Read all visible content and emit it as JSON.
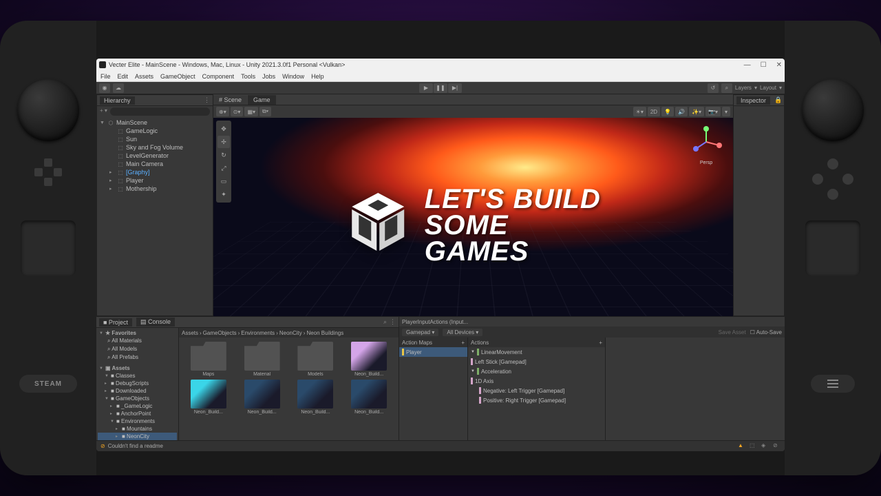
{
  "device": {
    "brand": "STEAM"
  },
  "window": {
    "title": "Vecter Elite - MainScene - Windows, Mac, Linux - Unity 2021.3.0f1 Personal <Vulkan>",
    "menubar": [
      "File",
      "Edit",
      "Assets",
      "GameObject",
      "Component",
      "Tools",
      "Jobs",
      "Window",
      "Help"
    ],
    "toolbar_right": {
      "layers": "Layers",
      "layout": "Layout"
    }
  },
  "hierarchy": {
    "title": "Hierarchy",
    "scene": "MainScene",
    "items": [
      {
        "name": "GameLogic",
        "depth": 1
      },
      {
        "name": "Sun",
        "depth": 1
      },
      {
        "name": "Sky and Fog Volume",
        "depth": 1
      },
      {
        "name": "LevelGenerator",
        "depth": 1
      },
      {
        "name": "Main Camera",
        "depth": 1
      },
      {
        "name": "[Graphy]",
        "depth": 1,
        "sel": true,
        "exp": true
      },
      {
        "name": "Player",
        "depth": 1,
        "exp": true
      },
      {
        "name": "Mothership",
        "depth": 1,
        "exp": true
      }
    ]
  },
  "scene": {
    "tabs": [
      {
        "label": "Scene",
        "active": true
      },
      {
        "label": "Game",
        "active": false
      }
    ],
    "gizmo_label": "Persp",
    "tools": {
      "shaded": "Shaded",
      "d2": "2D"
    }
  },
  "overlay": {
    "line1": "LET'S BUILD",
    "line2": "SOME GAMES"
  },
  "inspector": {
    "title": "Inspector"
  },
  "project": {
    "tabs": [
      {
        "label": "Project"
      },
      {
        "label": "Console"
      }
    ],
    "favorites": {
      "title": "Favorites",
      "items": [
        "All Materials",
        "All Models",
        "All Prefabs"
      ]
    },
    "assets": {
      "title": "Assets",
      "items": [
        {
          "name": "Classes",
          "exp": true
        },
        {
          "name": "DebugScripts",
          "exp": false
        },
        {
          "name": "Downloaded",
          "exp": false
        },
        {
          "name": "GameObjects",
          "exp": true
        },
        {
          "name": "_GameLogic",
          "exp": false,
          "depth": 1
        },
        {
          "name": "AnchorPoint",
          "exp": false,
          "depth": 1
        },
        {
          "name": "Environments",
          "exp": true,
          "depth": 1
        },
        {
          "name": "Mountains",
          "exp": false,
          "depth": 2
        },
        {
          "name": "NeonCity",
          "exp": false,
          "depth": 2,
          "sel": true
        }
      ]
    },
    "breadcrumb": [
      "Assets",
      "GameObjects",
      "Environments",
      "NeonCity",
      "Neon Buildings"
    ],
    "grid": [
      {
        "name": "Maps",
        "type": "folder"
      },
      {
        "name": "Material",
        "type": "folder"
      },
      {
        "name": "Models",
        "type": "folder"
      },
      {
        "name": "Neon_Build...",
        "type": "prefab",
        "color": "#d4a5e8"
      },
      {
        "name": "Neon_Build...",
        "type": "prefab",
        "color": "#3ad5e8"
      },
      {
        "name": "Neon_Build...",
        "type": "prefab",
        "color": "#2a4a6a"
      },
      {
        "name": "Neon_Build...",
        "type": "prefab",
        "color": "#2a4a6a"
      },
      {
        "name": "Neon_Build...",
        "type": "prefab",
        "color": "#2a4a6a"
      }
    ]
  },
  "input_actions": {
    "asset": "PlayerInputActions (Input...",
    "map_dd": "Gamepad",
    "devices_dd": "All Devices",
    "save": "Save Asset",
    "autosave": "Auto-Save",
    "maps": {
      "title": "Action Maps",
      "items": [
        "Player"
      ]
    },
    "actions": {
      "title": "Actions",
      "items": [
        {
          "name": "LinearMovement",
          "type": "action",
          "bar": "g"
        },
        {
          "name": "Left Stick [Gamepad]",
          "type": "binding",
          "bar": "p"
        },
        {
          "name": "Acceleration",
          "type": "action",
          "bar": "g"
        },
        {
          "name": "1D Axis",
          "type": "composite",
          "bar": "p"
        },
        {
          "name": "Negative: Left Trigger [Gamepad]",
          "type": "binding",
          "bar": "p",
          "depth": 1
        },
        {
          "name": "Positive: Right Trigger [Gamepad]",
          "type": "binding",
          "bar": "p",
          "depth": 1
        }
      ]
    }
  },
  "statusbar": {
    "message": "Couldn't find a readme"
  }
}
